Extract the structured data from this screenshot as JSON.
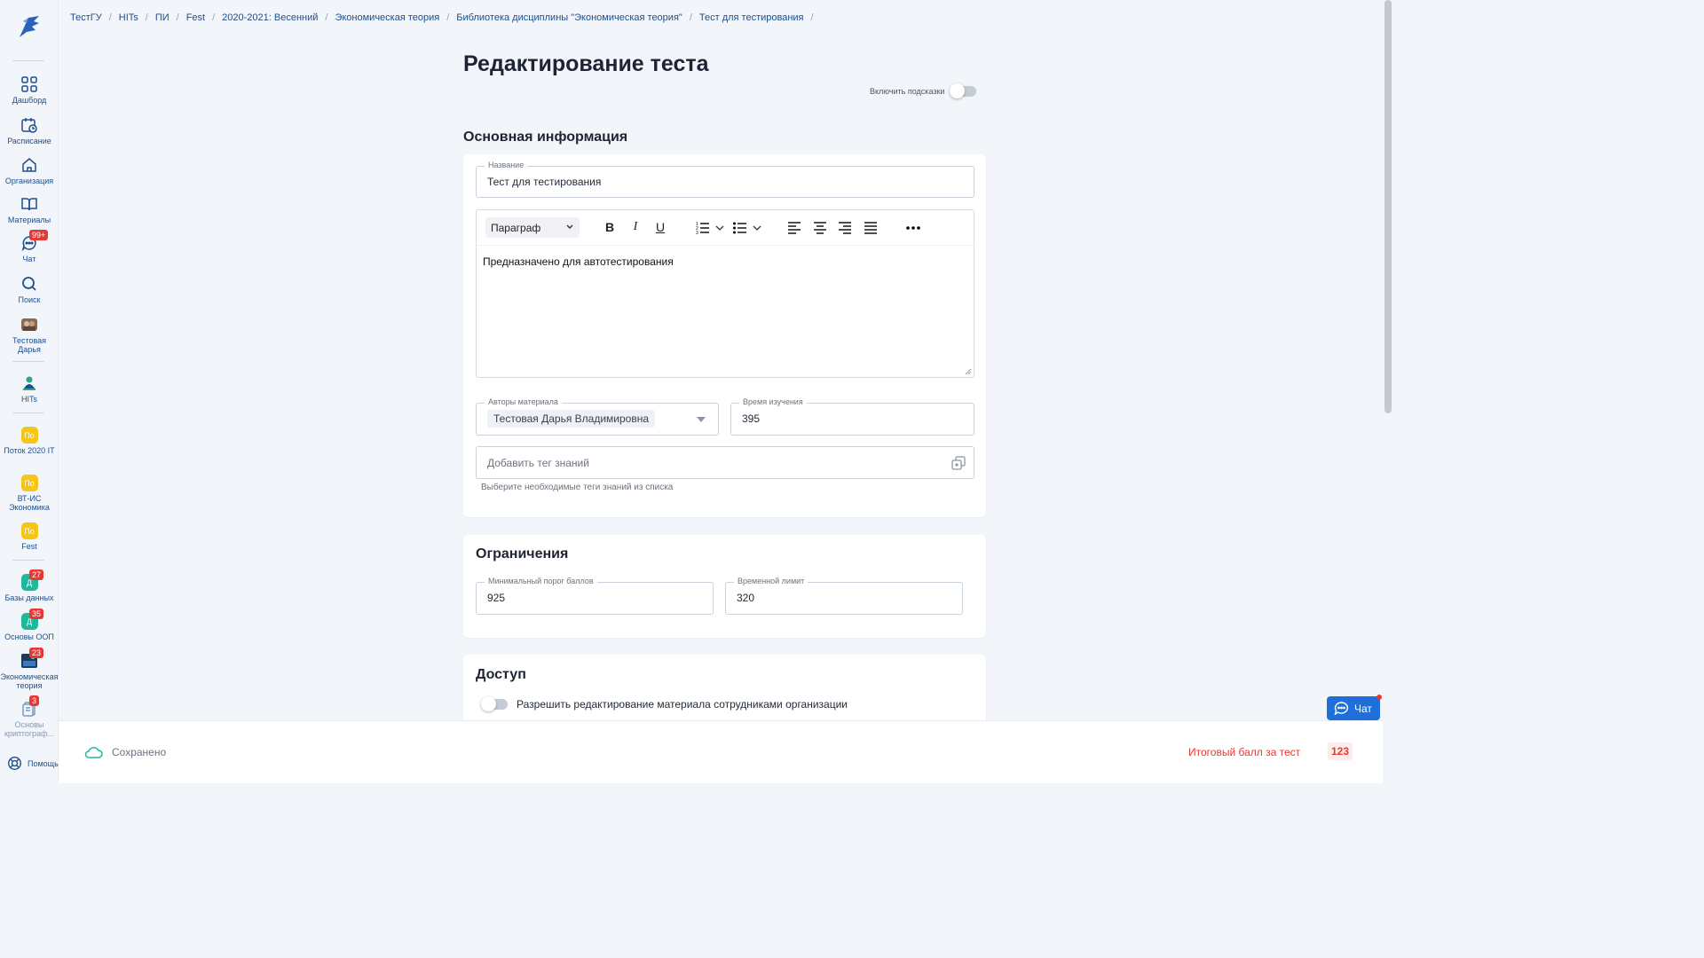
{
  "sidebar": {
    "items": [
      {
        "label": "Дашборд",
        "icon": "grid-icon"
      },
      {
        "label": "Расписание",
        "icon": "calendar-icon"
      },
      {
        "label": "Организация",
        "icon": "home-icon"
      },
      {
        "label": "Материалы",
        "icon": "book-icon"
      },
      {
        "label": "Чат",
        "icon": "chat-icon",
        "badge": "99+"
      },
      {
        "label": "Поиск",
        "icon": "search-icon"
      },
      {
        "label": "Тестовая Дарья",
        "icon": "avatar"
      },
      {
        "label": "HITs",
        "icon": "hits-logo"
      },
      {
        "label": "Поток 2020 IT",
        "prefix": "По"
      },
      {
        "label": "ВТ-ИС Экономика",
        "prefix": "По"
      },
      {
        "label": "Fest",
        "prefix": "По"
      },
      {
        "label": "Базы данных",
        "prefix": "Д",
        "badge": "27"
      },
      {
        "label": "Основы ООП",
        "prefix": "Д",
        "badge": "35"
      },
      {
        "label": "Экономическая теория",
        "badge": "23"
      },
      {
        "label": "Основы криптограф...",
        "badge": "3"
      }
    ],
    "help": "Помощь"
  },
  "breadcrumbs": [
    "ТестГУ",
    "HITs",
    "ПИ",
    "Fest",
    "2020-2021: Весенний",
    "Экономическая теория",
    "Библиотека дисциплины \"Экономическая теория\"",
    "Тест для тестирования"
  ],
  "page_title": "Редактирование теста",
  "hints_label": "Включить подсказки",
  "main_info": {
    "heading": "Основная информация",
    "name_label": "Название",
    "name_value": "Тест для тестирования",
    "editor": {
      "paragraph_select": "Параграф",
      "content": "Предназначено для автотестирования"
    },
    "authors_label": "Авторы материала",
    "author_chip": "Тестовая Дарья Владимировна",
    "study_time_label": "Время изучения",
    "study_time_value": "395",
    "tags_placeholder": "Добавить тег знаний",
    "tags_hint": "Выберите необходимые теги знаний из списка"
  },
  "limits": {
    "heading": "Ограничения",
    "min_score_label": "Минимальный порог баллов",
    "min_score_value": "925",
    "time_limit_label": "Временной лимит",
    "time_limit_value": "320"
  },
  "access": {
    "heading": "Доступ",
    "allow_edit_label": "Разрешить редактирование материала сотрудниками организации"
  },
  "bottom": {
    "saved": "Сохранено",
    "total_label": "Итоговый балл за тест",
    "total_value": "123"
  },
  "chat_button": "Чат",
  "colors": {
    "accent": "#1e6fd9",
    "link": "#1f4e8c",
    "danger": "#e53935",
    "yellow": "#f5c518",
    "teal": "#1fb89a"
  }
}
